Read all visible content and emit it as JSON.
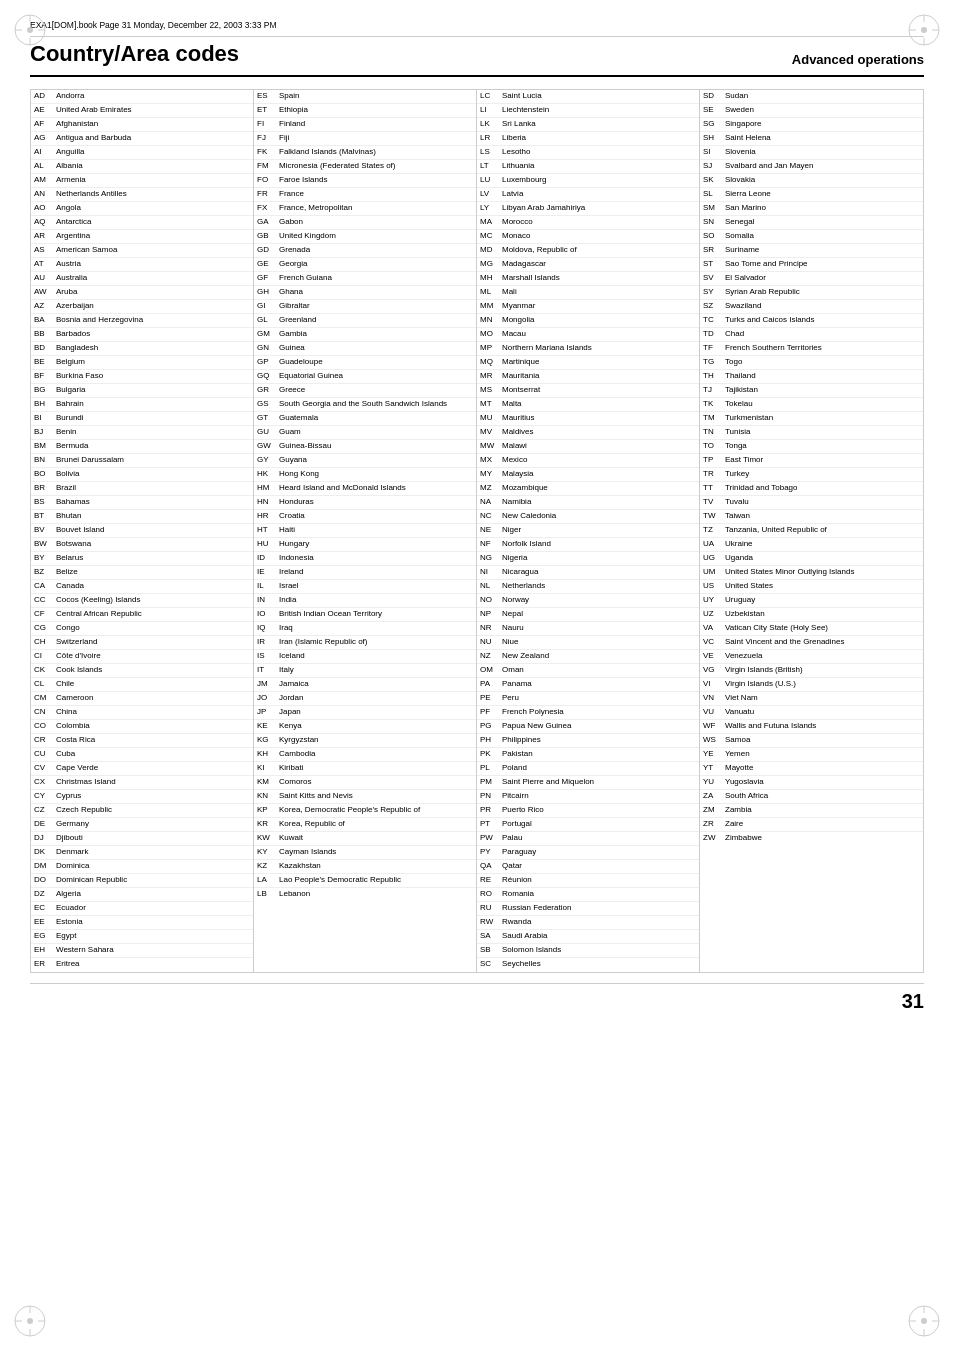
{
  "header": {
    "file_info": "EXA1[DOM].book  Page 31  Monday, December 22, 2003  3:33 PM",
    "page_title": "Country/Area codes",
    "section_label": "Advanced operations",
    "page_number": "31"
  },
  "columns": [
    {
      "rows": [
        {
          "code": "AD",
          "name": "Andorra"
        },
        {
          "code": "AE",
          "name": "United Arab Emirates"
        },
        {
          "code": "AF",
          "name": "Afghanistan"
        },
        {
          "code": "AG",
          "name": "Antigua and Barbuda"
        },
        {
          "code": "AI",
          "name": "Anguilla"
        },
        {
          "code": "AL",
          "name": "Albania"
        },
        {
          "code": "AM",
          "name": "Armenia"
        },
        {
          "code": "AN",
          "name": "Netherlands Antilles"
        },
        {
          "code": "AO",
          "name": "Angola"
        },
        {
          "code": "AQ",
          "name": "Antarctica"
        },
        {
          "code": "AR",
          "name": "Argentina"
        },
        {
          "code": "AS",
          "name": "American Samoa"
        },
        {
          "code": "AT",
          "name": "Austria"
        },
        {
          "code": "AU",
          "name": "Australia"
        },
        {
          "code": "AW",
          "name": "Aruba"
        },
        {
          "code": "AZ",
          "name": "Azerbaijan"
        },
        {
          "code": "BA",
          "name": "Bosnia and Herzegovina"
        },
        {
          "code": "BB",
          "name": "Barbados"
        },
        {
          "code": "BD",
          "name": "Bangladesh"
        },
        {
          "code": "BE",
          "name": "Belgium"
        },
        {
          "code": "BF",
          "name": "Burkina Faso"
        },
        {
          "code": "BG",
          "name": "Bulgaria"
        },
        {
          "code": "BH",
          "name": "Bahrain"
        },
        {
          "code": "BI",
          "name": "Burundi"
        },
        {
          "code": "BJ",
          "name": "Benin"
        },
        {
          "code": "BM",
          "name": "Bermuda"
        },
        {
          "code": "BN",
          "name": "Brunei Darussalam"
        },
        {
          "code": "BO",
          "name": "Bolivia"
        },
        {
          "code": "BR",
          "name": "Brazil"
        },
        {
          "code": "BS",
          "name": "Bahamas"
        },
        {
          "code": "BT",
          "name": "Bhutan"
        },
        {
          "code": "BV",
          "name": "Bouvet Island"
        },
        {
          "code": "BW",
          "name": "Botswana"
        },
        {
          "code": "BY",
          "name": "Belarus"
        },
        {
          "code": "BZ",
          "name": "Belize"
        },
        {
          "code": "CA",
          "name": "Canada"
        },
        {
          "code": "CC",
          "name": "Cocos (Keeling) Islands"
        },
        {
          "code": "CF",
          "name": "Central African Republic"
        },
        {
          "code": "CG",
          "name": "Congo"
        },
        {
          "code": "CH",
          "name": "Switzerland"
        },
        {
          "code": "CI",
          "name": "Côte d'Ivoire"
        },
        {
          "code": "CK",
          "name": "Cook Islands"
        },
        {
          "code": "CL",
          "name": "Chile"
        },
        {
          "code": "CM",
          "name": "Cameroon"
        },
        {
          "code": "CN",
          "name": "China"
        },
        {
          "code": "CO",
          "name": "Colombia"
        },
        {
          "code": "CR",
          "name": "Costa Rica"
        },
        {
          "code": "CU",
          "name": "Cuba"
        },
        {
          "code": "CV",
          "name": "Cape Verde"
        },
        {
          "code": "CX",
          "name": "Christmas Island"
        },
        {
          "code": "CY",
          "name": "Cyprus"
        },
        {
          "code": "CZ",
          "name": "Czech Republic"
        },
        {
          "code": "DE",
          "name": "Germany"
        },
        {
          "code": "DJ",
          "name": "Djibouti"
        },
        {
          "code": "DK",
          "name": "Denmark"
        },
        {
          "code": "DM",
          "name": "Dominica"
        },
        {
          "code": "DO",
          "name": "Dominican Republic"
        },
        {
          "code": "DZ",
          "name": "Algeria"
        },
        {
          "code": "EC",
          "name": "Ecuador"
        },
        {
          "code": "EE",
          "name": "Estonia"
        },
        {
          "code": "EG",
          "name": "Egypt"
        },
        {
          "code": "EH",
          "name": "Western Sahara"
        },
        {
          "code": "ER",
          "name": "Eritrea"
        }
      ]
    },
    {
      "rows": [
        {
          "code": "ES",
          "name": "Spain"
        },
        {
          "code": "ET",
          "name": "Ethiopia"
        },
        {
          "code": "FI",
          "name": "Finland"
        },
        {
          "code": "FJ",
          "name": "Fiji"
        },
        {
          "code": "FK",
          "name": "Falkland Islands (Malvinas)"
        },
        {
          "code": "FM",
          "name": "Micronesia (Federated States of)"
        },
        {
          "code": "FO",
          "name": "Faroe Islands"
        },
        {
          "code": "FR",
          "name": "France"
        },
        {
          "code": "FX",
          "name": "France, Metropolitan"
        },
        {
          "code": "GA",
          "name": "Gabon"
        },
        {
          "code": "GB",
          "name": "United Kingdom"
        },
        {
          "code": "GD",
          "name": "Grenada"
        },
        {
          "code": "GE",
          "name": "Georgia"
        },
        {
          "code": "GF",
          "name": "French Guiana"
        },
        {
          "code": "GH",
          "name": "Ghana"
        },
        {
          "code": "GI",
          "name": "Gibraltar"
        },
        {
          "code": "GL",
          "name": "Greenland"
        },
        {
          "code": "GM",
          "name": "Gambia"
        },
        {
          "code": "GN",
          "name": "Guinea"
        },
        {
          "code": "GP",
          "name": "Guadeloupe"
        },
        {
          "code": "GQ",
          "name": "Equatorial Guinea"
        },
        {
          "code": "GR",
          "name": "Greece"
        },
        {
          "code": "GS",
          "name": "South Georgia and the South Sandwich Islands"
        },
        {
          "code": "GT",
          "name": "Guatemala"
        },
        {
          "code": "GU",
          "name": "Guam"
        },
        {
          "code": "GW",
          "name": "Guinea-Bissau"
        },
        {
          "code": "GY",
          "name": "Guyana"
        },
        {
          "code": "HK",
          "name": "Hong Kong"
        },
        {
          "code": "HM",
          "name": "Heard Island and McDonald Islands"
        },
        {
          "code": "HN",
          "name": "Honduras"
        },
        {
          "code": "HR",
          "name": "Croatia"
        },
        {
          "code": "HT",
          "name": "Haiti"
        },
        {
          "code": "HU",
          "name": "Hungary"
        },
        {
          "code": "ID",
          "name": "Indonesia"
        },
        {
          "code": "IE",
          "name": "Ireland"
        },
        {
          "code": "IL",
          "name": "Israel"
        },
        {
          "code": "IN",
          "name": "India"
        },
        {
          "code": "IO",
          "name": "British Indian Ocean Territory"
        },
        {
          "code": "IQ",
          "name": "Iraq"
        },
        {
          "code": "IR",
          "name": "Iran (Islamic Republic of)"
        },
        {
          "code": "IS",
          "name": "Iceland"
        },
        {
          "code": "IT",
          "name": "Italy"
        },
        {
          "code": "JM",
          "name": "Jamaica"
        },
        {
          "code": "JO",
          "name": "Jordan"
        },
        {
          "code": "JP",
          "name": "Japan"
        },
        {
          "code": "KE",
          "name": "Kenya"
        },
        {
          "code": "KG",
          "name": "Kyrgyzstan"
        },
        {
          "code": "KH",
          "name": "Cambodia"
        },
        {
          "code": "KI",
          "name": "Kiribati"
        },
        {
          "code": "KM",
          "name": "Comoros"
        },
        {
          "code": "KN",
          "name": "Saint Kitts and Nevis"
        },
        {
          "code": "KP",
          "name": "Korea, Democratic People's Republic of"
        },
        {
          "code": "KR",
          "name": "Korea, Republic of"
        },
        {
          "code": "KW",
          "name": "Kuwait"
        },
        {
          "code": "KY",
          "name": "Cayman Islands"
        },
        {
          "code": "KZ",
          "name": "Kazakhstan"
        },
        {
          "code": "LA",
          "name": "Lao People's Democratic Republic"
        },
        {
          "code": "LB",
          "name": "Lebanon"
        }
      ]
    },
    {
      "rows": [
        {
          "code": "LC",
          "name": "Saint Lucia"
        },
        {
          "code": "LI",
          "name": "Liechtenstein"
        },
        {
          "code": "LK",
          "name": "Sri Lanka"
        },
        {
          "code": "LR",
          "name": "Liberia"
        },
        {
          "code": "LS",
          "name": "Lesotho"
        },
        {
          "code": "LT",
          "name": "Lithuania"
        },
        {
          "code": "LU",
          "name": "Luxembourg"
        },
        {
          "code": "LV",
          "name": "Latvia"
        },
        {
          "code": "LY",
          "name": "Libyan Arab Jamahiriya"
        },
        {
          "code": "MA",
          "name": "Morocco"
        },
        {
          "code": "MC",
          "name": "Monaco"
        },
        {
          "code": "MD",
          "name": "Moldova, Republic of"
        },
        {
          "code": "MG",
          "name": "Madagascar"
        },
        {
          "code": "MH",
          "name": "Marshall Islands"
        },
        {
          "code": "ML",
          "name": "Mali"
        },
        {
          "code": "MM",
          "name": "Myanmar"
        },
        {
          "code": "MN",
          "name": "Mongolia"
        },
        {
          "code": "MO",
          "name": "Macau"
        },
        {
          "code": "MP",
          "name": "Northern Mariana Islands"
        },
        {
          "code": "MQ",
          "name": "Martinique"
        },
        {
          "code": "MR",
          "name": "Mauritania"
        },
        {
          "code": "MS",
          "name": "Montserrat"
        },
        {
          "code": "MT",
          "name": "Malta"
        },
        {
          "code": "MU",
          "name": "Mauritius"
        },
        {
          "code": "MV",
          "name": "Maldives"
        },
        {
          "code": "MW",
          "name": "Malawi"
        },
        {
          "code": "MX",
          "name": "Mexico"
        },
        {
          "code": "MY",
          "name": "Malaysia"
        },
        {
          "code": "MZ",
          "name": "Mozambique"
        },
        {
          "code": "NA",
          "name": "Namibia"
        },
        {
          "code": "NC",
          "name": "New Caledonia"
        },
        {
          "code": "NE",
          "name": "Niger"
        },
        {
          "code": "NF",
          "name": "Norfolk Island"
        },
        {
          "code": "NG",
          "name": "Nigeria"
        },
        {
          "code": "NI",
          "name": "Nicaragua"
        },
        {
          "code": "NL",
          "name": "Netherlands"
        },
        {
          "code": "NO",
          "name": "Norway"
        },
        {
          "code": "NP",
          "name": "Nepal"
        },
        {
          "code": "NR",
          "name": "Nauru"
        },
        {
          "code": "NU",
          "name": "Niue"
        },
        {
          "code": "NZ",
          "name": "New Zealand"
        },
        {
          "code": "OM",
          "name": "Oman"
        },
        {
          "code": "PA",
          "name": "Panama"
        },
        {
          "code": "PE",
          "name": "Peru"
        },
        {
          "code": "PF",
          "name": "French Polynesia"
        },
        {
          "code": "PG",
          "name": "Papua New Guinea"
        },
        {
          "code": "PH",
          "name": "Philippines"
        },
        {
          "code": "PK",
          "name": "Pakistan"
        },
        {
          "code": "PL",
          "name": "Poland"
        },
        {
          "code": "PM",
          "name": "Saint Pierre and Miquelon"
        },
        {
          "code": "PN",
          "name": "Pitcairn"
        },
        {
          "code": "PR",
          "name": "Puerto Rico"
        },
        {
          "code": "PT",
          "name": "Portugal"
        },
        {
          "code": "PW",
          "name": "Palau"
        },
        {
          "code": "PY",
          "name": "Paraguay"
        },
        {
          "code": "QA",
          "name": "Qatar"
        },
        {
          "code": "RE",
          "name": "Réunion"
        },
        {
          "code": "RO",
          "name": "Romania"
        },
        {
          "code": "RU",
          "name": "Russian Federation"
        },
        {
          "code": "RW",
          "name": "Rwanda"
        },
        {
          "code": "SA",
          "name": "Saudi Arabia"
        },
        {
          "code": "SB",
          "name": "Solomon Islands"
        },
        {
          "code": "SC",
          "name": "Seychelles"
        }
      ]
    },
    {
      "rows": [
        {
          "code": "SD",
          "name": "Sudan"
        },
        {
          "code": "SE",
          "name": "Sweden"
        },
        {
          "code": "SG",
          "name": "Singapore"
        },
        {
          "code": "SH",
          "name": "Saint Helena"
        },
        {
          "code": "SI",
          "name": "Slovenia"
        },
        {
          "code": "SJ",
          "name": "Svalbard and Jan Mayen"
        },
        {
          "code": "SK",
          "name": "Slovakia"
        },
        {
          "code": "SL",
          "name": "Sierra Leone"
        },
        {
          "code": "SM",
          "name": "San Marino"
        },
        {
          "code": "SN",
          "name": "Senegal"
        },
        {
          "code": "SO",
          "name": "Somalia"
        },
        {
          "code": "SR",
          "name": "Suriname"
        },
        {
          "code": "ST",
          "name": "Sao Tome and Principe"
        },
        {
          "code": "SV",
          "name": "El Salvador"
        },
        {
          "code": "SY",
          "name": "Syrian Arab Republic"
        },
        {
          "code": "SZ",
          "name": "Swaziland"
        },
        {
          "code": "TC",
          "name": "Turks and Caicos Islands"
        },
        {
          "code": "TD",
          "name": "Chad"
        },
        {
          "code": "TF",
          "name": "French Southern Territories"
        },
        {
          "code": "TG",
          "name": "Togo"
        },
        {
          "code": "TH",
          "name": "Thailand"
        },
        {
          "code": "TJ",
          "name": "Tajikistan"
        },
        {
          "code": "TK",
          "name": "Tokelau"
        },
        {
          "code": "TM",
          "name": "Turkmenistan"
        },
        {
          "code": "TN",
          "name": "Tunisia"
        },
        {
          "code": "TO",
          "name": "Tonga"
        },
        {
          "code": "TP",
          "name": "East Timor"
        },
        {
          "code": "TR",
          "name": "Turkey"
        },
        {
          "code": "TT",
          "name": "Trinidad and Tobago"
        },
        {
          "code": "TV",
          "name": "Tuvalu"
        },
        {
          "code": "TW",
          "name": "Taiwan"
        },
        {
          "code": "TZ",
          "name": "Tanzania, United Republic of"
        },
        {
          "code": "UA",
          "name": "Ukraine"
        },
        {
          "code": "UG",
          "name": "Uganda"
        },
        {
          "code": "UM",
          "name": "United States Minor Outlying Islands"
        },
        {
          "code": "US",
          "name": "United States"
        },
        {
          "code": "UY",
          "name": "Uruguay"
        },
        {
          "code": "UZ",
          "name": "Uzbekistan"
        },
        {
          "code": "VA",
          "name": "Vatican City State (Holy See)"
        },
        {
          "code": "VC",
          "name": "Saint Vincent and the Grenadines"
        },
        {
          "code": "VE",
          "name": "Venezuela"
        },
        {
          "code": "VG",
          "name": "Virgin Islands (British)"
        },
        {
          "code": "VI",
          "name": "Virgin Islands (U.S.)"
        },
        {
          "code": "VN",
          "name": "Viet Nam"
        },
        {
          "code": "VU",
          "name": "Vanuatu"
        },
        {
          "code": "WF",
          "name": "Wallis and Futuna Islands"
        },
        {
          "code": "WS",
          "name": "Samoa"
        },
        {
          "code": "YE",
          "name": "Yemen"
        },
        {
          "code": "YT",
          "name": "Mayotte"
        },
        {
          "code": "YU",
          "name": "Yugoslavia"
        },
        {
          "code": "ZA",
          "name": "South Africa"
        },
        {
          "code": "ZM",
          "name": "Zambia"
        },
        {
          "code": "ZR",
          "name": "Zaire"
        },
        {
          "code": "ZW",
          "name": "Zimbabwe"
        }
      ]
    }
  ]
}
